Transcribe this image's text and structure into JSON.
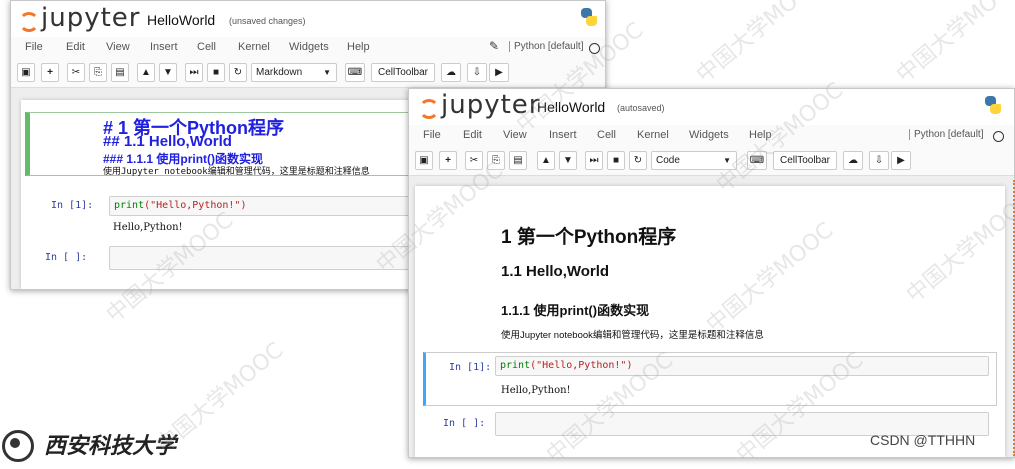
{
  "watermark": "中国大学MOOC",
  "logo_text": "jupyter",
  "window1": {
    "notebook_name": "HelloWorld",
    "status": "(unsaved changes)",
    "menu": [
      "File",
      "Edit",
      "View",
      "Insert",
      "Cell",
      "Kernel",
      "Widgets",
      "Help"
    ],
    "kernel": "Python [default]",
    "celltype": "Markdown",
    "celltoolbar": "CellToolbar",
    "markdown_src": {
      "h1": "# 1 第一个Python程序",
      "h2": "## 1.1 Hello,World",
      "h3": "### 1.1.1 使用print()函数实现",
      "para": "使用Jupyter notebook编辑和管理代码，这里是标题和注释信息"
    },
    "cell1_prompt": "In  [1]:",
    "cell1_code_fn": "print",
    "cell1_code_str": "(\"Hello,Python!\")",
    "cell1_output": "Hello,Python!",
    "cell2_prompt": "In  [ ]:"
  },
  "window2": {
    "notebook_name": "HelloWorld",
    "status": "(autosaved)",
    "menu": [
      "File",
      "Edit",
      "View",
      "Insert",
      "Cell",
      "Kernel",
      "Widgets",
      "Help"
    ],
    "kernel": "Python [default]",
    "celltype": "Code",
    "celltoolbar": "CellToolbar",
    "h1": "1 第一个Python程序",
    "h2": "1.1 Hello,World",
    "h3": "1.1.1 使用print()函数实现",
    "para": "使用Jupyter notebook编辑和管理代码，这里是标题和注释信息",
    "cell1_prompt": "In  [1]:",
    "cell1_code_fn": "print",
    "cell1_code_str": "(\"Hello,Python!\")",
    "cell1_output": "Hello,Python!",
    "cell2_prompt": "In  [ ]:"
  },
  "footer": {
    "university": "西安科技大学",
    "credit": "CSDN @TTHHN"
  },
  "colors": {
    "jupyter_orange": "#f37726",
    "markdown_blue": "#2020e0",
    "prompt_blue": "#303f9f"
  }
}
